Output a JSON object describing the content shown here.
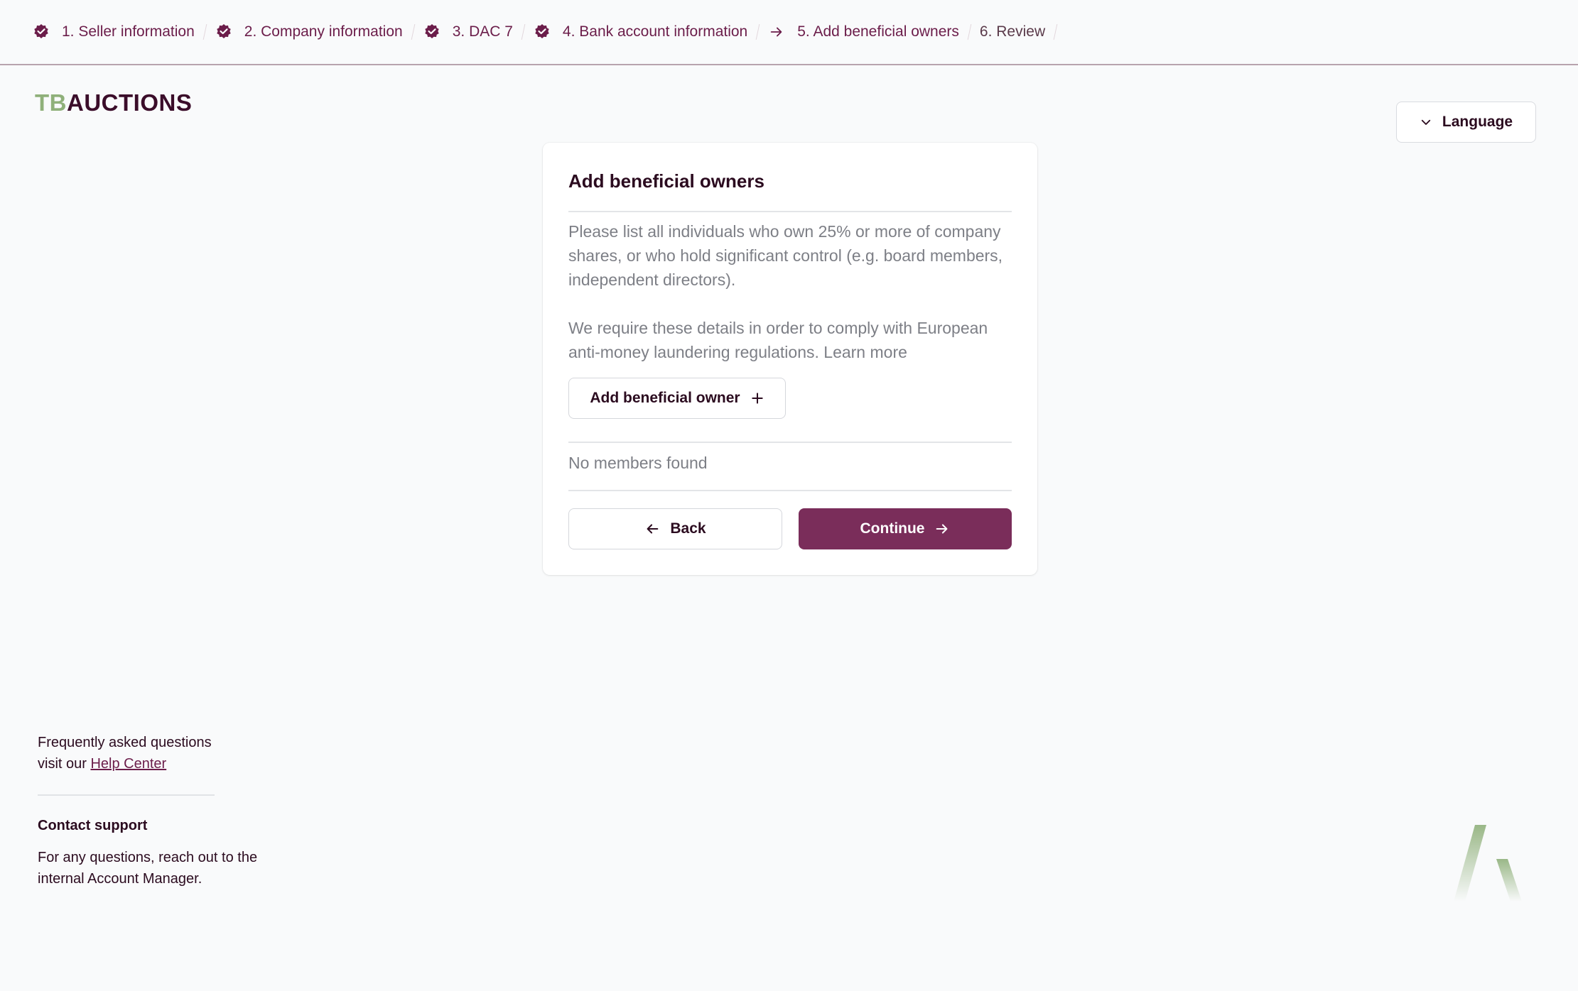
{
  "stepper": {
    "steps": [
      {
        "label": "1. Seller information",
        "state": "done"
      },
      {
        "label": "2. Company information",
        "state": "done"
      },
      {
        "label": "3. DAC 7",
        "state": "done"
      },
      {
        "label": "4. Bank account information",
        "state": "done"
      },
      {
        "label": "5. Add beneficial owners",
        "state": "current"
      },
      {
        "label": "6. Review",
        "state": "upcoming"
      }
    ]
  },
  "logo": {
    "tb": "TB",
    "rest": "AUCTIONS"
  },
  "language_button": {
    "label": "Language",
    "icon": "chevron-down-icon"
  },
  "card": {
    "title": "Add beneficial owners",
    "paragraph1": "Please list all individuals who own 25% or more of company shares, or who hold significant control (e.g. board members, independent directors).",
    "paragraph2": "We require these details in order to comply with European anti-money laundering regulations. Learn more",
    "add_button": "Add beneficial owner",
    "empty_state": "No members found",
    "back_button": "Back",
    "continue_button": "Continue"
  },
  "footer": {
    "faq_line1": "Frequently asked questions",
    "faq_line2_prefix": "visit our ",
    "faq_link": "Help Center",
    "support_title": "Contact support",
    "support_text": "For any questions, reach out to the internal Account Manager."
  },
  "colors": {
    "brand_primary": "#7a2d5a",
    "brand_dark": "#3b0d2a",
    "brand_green": "#8fb07a",
    "background": "#f9fafb"
  }
}
